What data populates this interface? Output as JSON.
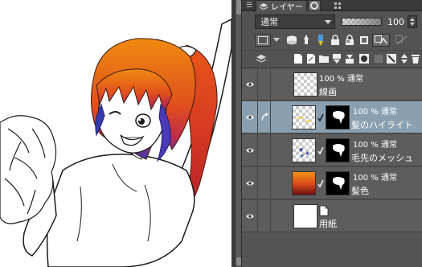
{
  "canvas": {
    "colors": {
      "hair_top": "#e0561c",
      "hair_bottom": "#2a3aa8",
      "line": "#1a1a1a"
    }
  },
  "panel": {
    "tab_label": "レイヤー",
    "blend_mode": "通常",
    "opacity": "100",
    "layers": [
      {
        "name": "線画",
        "opacity": "100 %",
        "mode": "通常",
        "thumb": "checker",
        "has_mask": false,
        "selected": false,
        "clipped": false
      },
      {
        "name": "髪のハイライト",
        "opacity": "100 %",
        "mode": "通常",
        "thumb": "checker-yellow",
        "has_mask": true,
        "selected": true,
        "clipped": true
      },
      {
        "name": "毛先のメッシュ",
        "opacity": "100 %",
        "mode": "通常",
        "thumb": "checker-blue",
        "has_mask": true,
        "selected": false,
        "clipped": false
      },
      {
        "name": "髪色",
        "opacity": "100 %",
        "mode": "通常",
        "thumb": "gradient",
        "has_mask": true,
        "selected": false,
        "clipped": false
      },
      {
        "name": "用紙",
        "opacity": "",
        "mode": "",
        "thumb": "white",
        "has_mask": false,
        "selected": false,
        "clipped": false
      }
    ],
    "colors": {
      "selected_row": "#8aa0b0",
      "panel_bg": "#535353"
    }
  }
}
